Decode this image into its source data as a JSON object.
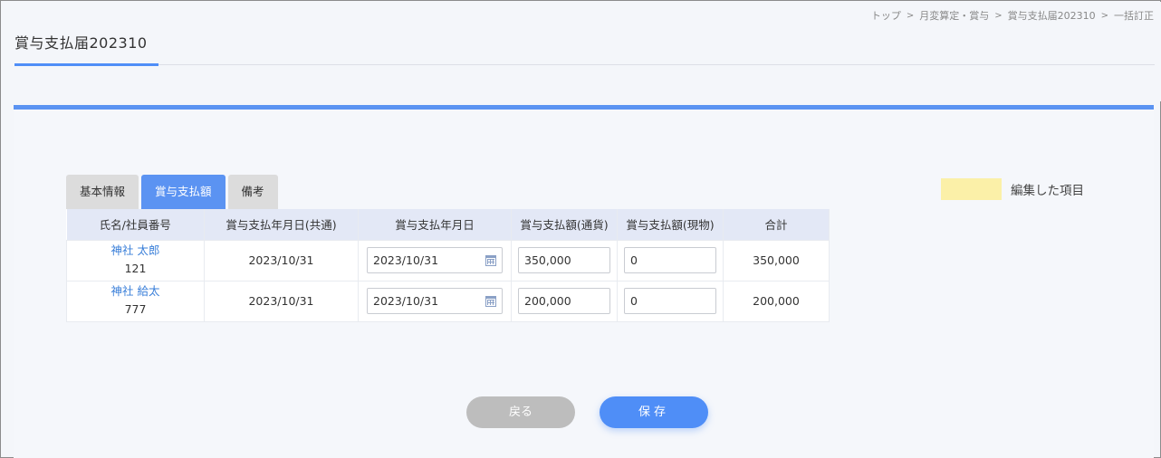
{
  "breadcrumb": [
    "トップ",
    "月変算定・賞与",
    "賞与支払届202310",
    "一括訂正"
  ],
  "breadcrumb_sep": ">",
  "page_title": "賞与支払届202310",
  "tabs": [
    {
      "label": "基本情報",
      "active": false
    },
    {
      "label": "賞与支払額",
      "active": true
    },
    {
      "label": "備考",
      "active": false
    }
  ],
  "legend": {
    "label": "編集した項目",
    "color": "#fbf0a8"
  },
  "table": {
    "headers": [
      "氏名/社員番号",
      "賞与支払年月日(共通)",
      "賞与支払年月日",
      "賞与支払額(通貨)",
      "賞与支払額(現物)",
      "合計"
    ],
    "rows": [
      {
        "name": "神社 太郎",
        "emp_no": "121",
        "common_date": "2023/10/31",
        "date": "2023/10/31",
        "cash": "350,000",
        "in_kind": "0",
        "total": "350,000"
      },
      {
        "name": "神社 給太",
        "emp_no": "777",
        "common_date": "2023/10/31",
        "date": "2023/10/31",
        "cash": "200,000",
        "in_kind": "0",
        "total": "200,000"
      }
    ]
  },
  "buttons": {
    "back": "戻る",
    "save": "保存"
  },
  "colors": {
    "accent": "#5b93f2",
    "link": "#3a7fd9",
    "header_bg": "#e3e8f6"
  },
  "icons": {
    "date_picker": "calendar-icon"
  }
}
